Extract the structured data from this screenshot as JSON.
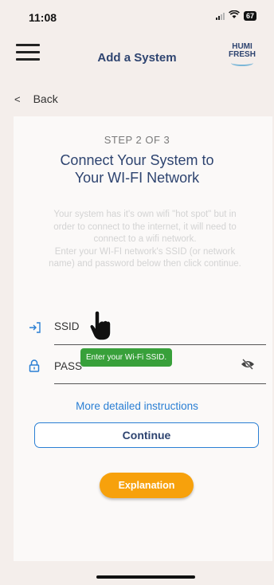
{
  "status_bar": {
    "time": "11:08",
    "battery": "67"
  },
  "header": {
    "title": "Add a System",
    "logo_line1": "HUMI",
    "logo_line2": "FRESH"
  },
  "nav": {
    "back_label": "Back",
    "back_chevron": "<"
  },
  "main": {
    "step": "STEP 2 OF 3",
    "heading_line1": "Connect Your System to",
    "heading_line2": "Your WI-FI Network",
    "desc_line1": "Your system has it's own wifi \"hot spot\" but in",
    "desc_line2": "order to connect to the internet, it will need to",
    "desc_line3": "connect to a wifi network.",
    "desc_line4": "Enter your WI-FI network's SSID (or network",
    "desc_line5": "name) and password below then click continue."
  },
  "form": {
    "ssid_label": "SSID",
    "password_label": "PASS",
    "ssid_tooltip": "Enter your Wi-Fi SSID."
  },
  "links": {
    "more_instructions": "More detailed instructions"
  },
  "buttons": {
    "continue": "Continue",
    "explanation": "Explanation"
  },
  "icons": {
    "menu": "hamburger-menu-icon",
    "login": "login-arrow-icon",
    "lock": "lock-icon",
    "visibility": "eye-off-icon",
    "cursor": "pointer-hand-icon"
  },
  "colors": {
    "primary_text": "#2e4470",
    "accent_blue": "#2a7fd4",
    "tooltip_green": "#38a03a",
    "explanation_orange": "#f7a10c",
    "background": "#f4eeeb"
  }
}
